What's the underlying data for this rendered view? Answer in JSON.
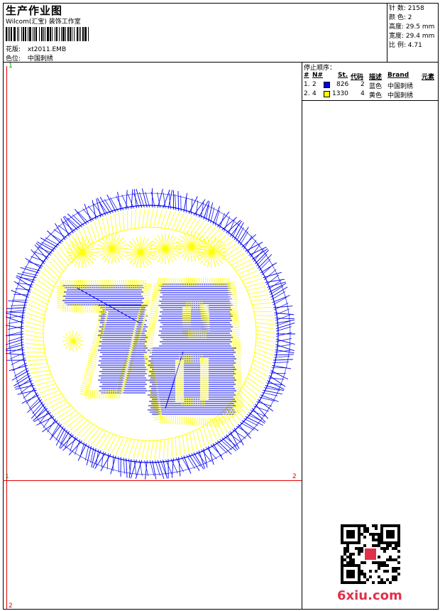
{
  "header": {
    "title": "生产作业图",
    "company": "Wilcom(汇宝) 装饰工作室",
    "design_label": "花版:",
    "design_value": "xt2011.EMB",
    "colorway_label": "色位:",
    "colorway_value": "中国刺绣"
  },
  "stats": {
    "stitches_label": "针 数:",
    "stitches_value": "2158",
    "colors_label": "颜 色:",
    "colors_value": "2",
    "height_label": "高度:",
    "height_value": "29.5 mm",
    "width_label": "宽度:",
    "width_value": "29.4 mm",
    "scale_label": "比 例:",
    "scale_value": "4.71"
  },
  "stop_sequence": {
    "title": "停止顺序：",
    "headers": [
      "#",
      "N#",
      "St.",
      "代码",
      "描述",
      "Brand",
      "元素"
    ],
    "rows": [
      {
        "idx": "1.",
        "n": "2",
        "st": "826",
        "code": "2",
        "desc": "蓝色",
        "brand": "中国刺绣",
        "color": "#0000ee"
      },
      {
        "idx": "2.",
        "n": "4",
        "st": "1330",
        "code": "4",
        "desc": "黄色",
        "brand": "中国刺绣",
        "color": "#ffff00"
      }
    ]
  },
  "markers": {
    "top_left": "1",
    "mid_left": "1",
    "mid_right": "2",
    "bottom_left": "2"
  },
  "watermark": {
    "site": "6xiu.com"
  },
  "colors": {
    "blue": "#0000ee",
    "yellow": "#ffff00",
    "red": "#e00000"
  }
}
